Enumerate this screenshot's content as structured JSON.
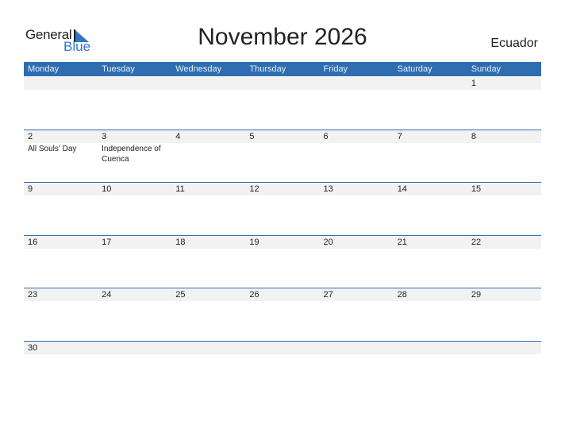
{
  "logo": {
    "word1": "General",
    "word2": "Blue"
  },
  "title": "November 2026",
  "country": "Ecuador",
  "colors": {
    "header_bg": "#2e6eb0",
    "logo_blue": "#2e78c6",
    "band": "#f2f2f2"
  },
  "weekdays": [
    "Monday",
    "Tuesday",
    "Wednesday",
    "Thursday",
    "Friday",
    "Saturday",
    "Sunday"
  ],
  "weeks": [
    {
      "days": [
        "",
        "",
        "",
        "",
        "",
        "",
        "1"
      ],
      "events": [
        "",
        "",
        "",
        "",
        "",
        "",
        ""
      ]
    },
    {
      "days": [
        "2",
        "3",
        "4",
        "5",
        "6",
        "7",
        "8"
      ],
      "events": [
        "All Souls' Day",
        "Independence of Cuenca",
        "",
        "",
        "",
        "",
        ""
      ]
    },
    {
      "days": [
        "9",
        "10",
        "11",
        "12",
        "13",
        "14",
        "15"
      ],
      "events": [
        "",
        "",
        "",
        "",
        "",
        "",
        ""
      ]
    },
    {
      "days": [
        "16",
        "17",
        "18",
        "19",
        "20",
        "21",
        "22"
      ],
      "events": [
        "",
        "",
        "",
        "",
        "",
        "",
        ""
      ]
    },
    {
      "days": [
        "23",
        "24",
        "25",
        "26",
        "27",
        "28",
        "29"
      ],
      "events": [
        "",
        "",
        "",
        "",
        "",
        "",
        ""
      ]
    },
    {
      "days": [
        "30",
        "",
        "",
        "",
        "",
        "",
        ""
      ],
      "events": [
        "",
        "",
        "",
        "",
        "",
        "",
        ""
      ]
    }
  ]
}
